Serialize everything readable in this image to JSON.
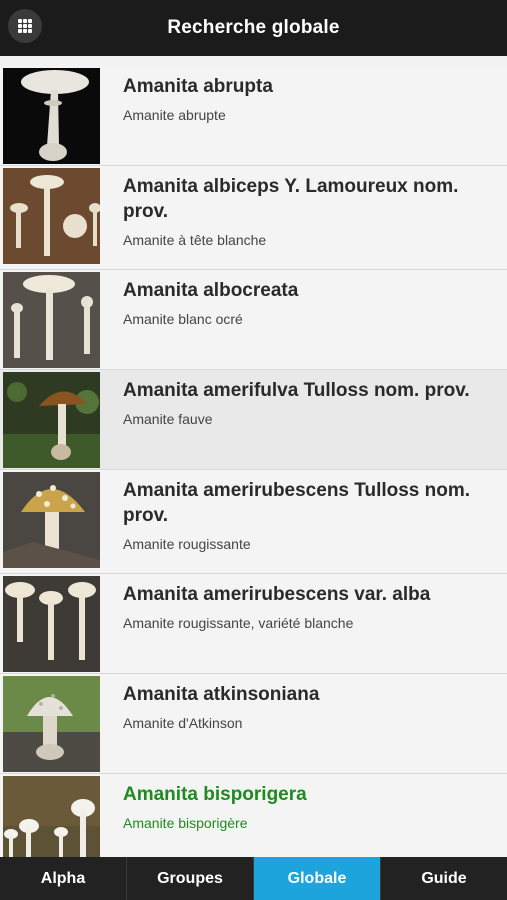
{
  "header": {
    "title": "Recherche globale"
  },
  "results": [
    {
      "name": "Amanita abrupta",
      "common": "Amanite abrupte"
    },
    {
      "name": "Amanita albiceps Y. Lamoureux nom. prov.",
      "common": "Amanite à tête blanche"
    },
    {
      "name": "Amanita albocreata",
      "common": "Amanite blanc ocré"
    },
    {
      "name": "Amanita amerifulva Tulloss nom. prov.",
      "common": "Amanite fauve"
    },
    {
      "name": "Amanita amerirubescens Tulloss nom. prov.",
      "common": "Amanite rougissante"
    },
    {
      "name": "Amanita amerirubescens var. alba",
      "common": "Amanite rougissante, variété blanche"
    },
    {
      "name": "Amanita atkinsoniana",
      "common": "Amanite d'Atkinson"
    },
    {
      "name": "Amanita bisporigera",
      "common": "Amanite bisporigère"
    }
  ],
  "tabs": [
    {
      "label": "Alpha"
    },
    {
      "label": "Groupes"
    },
    {
      "label": "Globale",
      "active": true
    },
    {
      "label": "Guide"
    }
  ],
  "colors": {
    "header_bg": "#1b1b1b",
    "tab_active": "#1ea4dd",
    "selected_text": "#1f8a1f"
  },
  "icons": {
    "menu": "grid-icon"
  }
}
